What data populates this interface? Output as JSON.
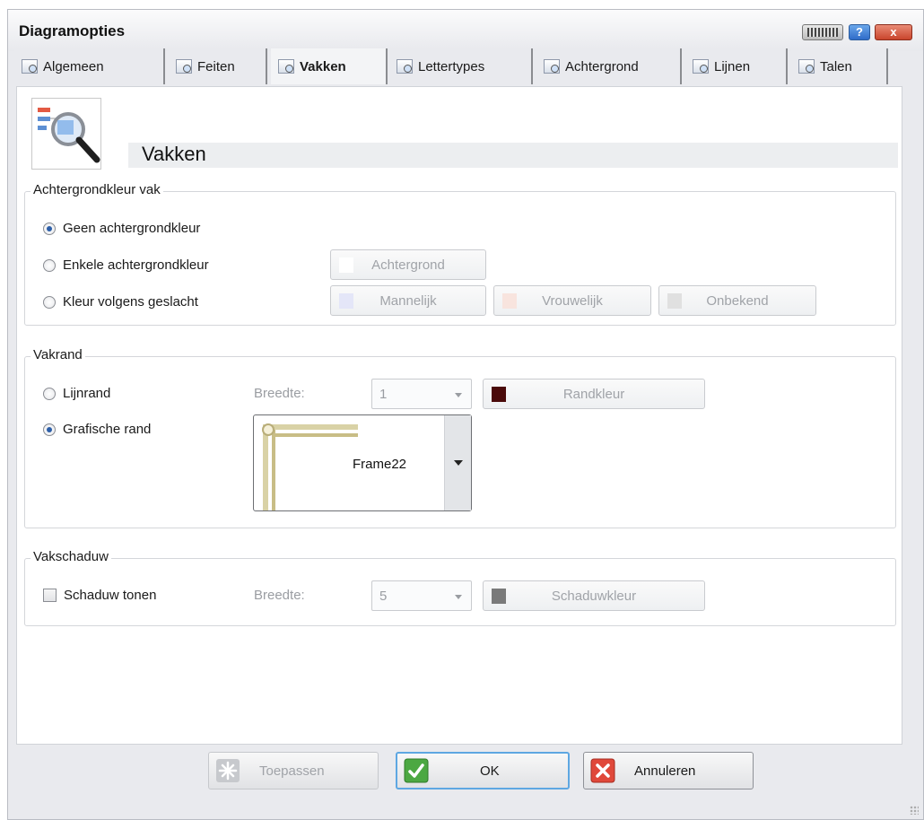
{
  "window": {
    "title": "Diagramopties"
  },
  "titlebar": {
    "help_label": "?",
    "close_label": "x"
  },
  "tabs": [
    {
      "label": "Algemeen"
    },
    {
      "label": "Feiten"
    },
    {
      "label": "Vakken"
    },
    {
      "label": "Lettertypes"
    },
    {
      "label": "Achtergrond"
    },
    {
      "label": "Lijnen"
    },
    {
      "label": "Talen"
    }
  ],
  "active_tab": "Vakken",
  "header": {
    "title": "Vakken"
  },
  "background_group": {
    "legend": "Achtergrondkleur vak",
    "options": [
      "Geen achtergrondkleur",
      "Enkele achtergrondkleur",
      "Kleur volgens geslacht"
    ],
    "selected": "Geen achtergrondkleur",
    "background_button": "Achtergrond",
    "male_button": "Mannelijk",
    "female_button": "Vrouwelijk",
    "unknown_button": "Onbekend",
    "colors": {
      "background": "#ffffff",
      "male": "#e4e6f8",
      "female": "#f8e4de",
      "unknown": "#e0e0e0"
    }
  },
  "border_group": {
    "legend": "Vakrand",
    "options": [
      "Lijnrand",
      "Grafische rand"
    ],
    "selected": "Grafische rand",
    "width_label": "Breedte:",
    "width_value": "1",
    "color_button": "Randkleur",
    "color": "#4a0a0a",
    "frame_value": "Frame22"
  },
  "shadow_group": {
    "legend": "Vakschaduw",
    "checkbox_label": "Schaduw tonen",
    "checked": false,
    "width_label": "Breedte:",
    "width_value": "5",
    "color_button": "Schaduwkleur",
    "color": "#7a7a7a"
  },
  "footer": {
    "apply": "Toepassen",
    "ok": "OK",
    "cancel": "Annuleren"
  }
}
